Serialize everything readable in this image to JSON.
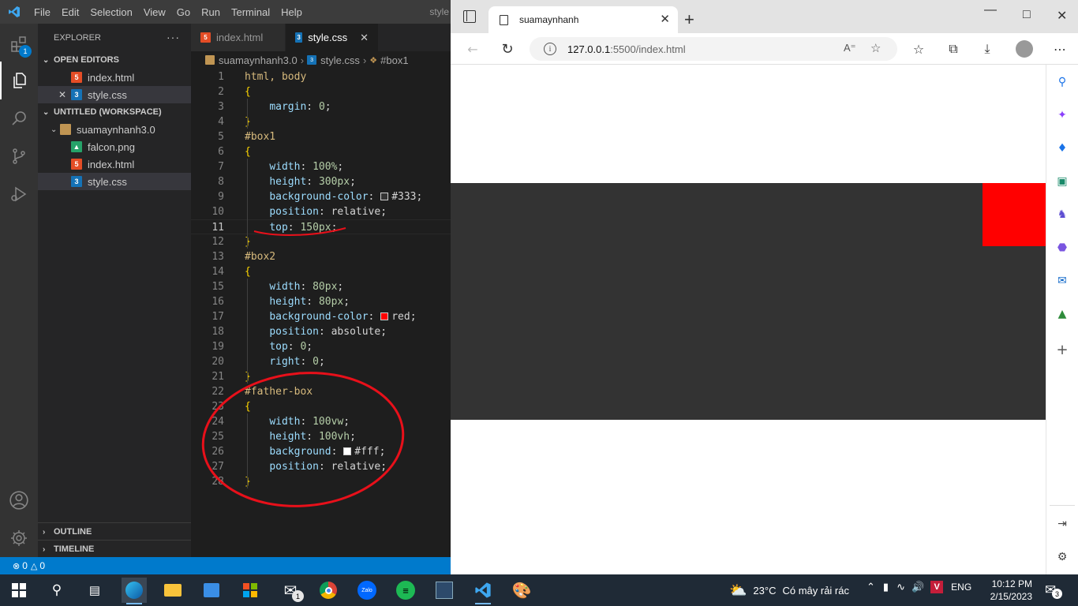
{
  "vscode": {
    "menu": [
      "File",
      "Edit",
      "Selection",
      "View",
      "Go",
      "Run",
      "Terminal",
      "Help"
    ],
    "window_title": "style",
    "explorer_title": "EXPLORER",
    "explorer_more": "···",
    "badge_count": "1",
    "open_editors_label": "OPEN EDITORS",
    "open_editors": [
      {
        "name": "index.html",
        "type": "html"
      },
      {
        "name": "style.css",
        "type": "css"
      }
    ],
    "workspace_label": "UNTITLED (WORKSPACE)",
    "folder": "suamaynhanh3.0",
    "files": [
      {
        "name": "falcon.png",
        "type": "png"
      },
      {
        "name": "index.html",
        "type": "html"
      },
      {
        "name": "style.css",
        "type": "css"
      }
    ],
    "outline_label": "OUTLINE",
    "timeline_label": "TIMELINE",
    "tabs": [
      {
        "label": "index.html",
        "type": "html"
      },
      {
        "label": "style.css",
        "type": "css"
      }
    ],
    "breadcrumb": [
      "suamaynhanh3.0",
      "style.css",
      "#box1"
    ],
    "status": {
      "errors": "0",
      "warnings": "0"
    },
    "current_line": 11,
    "code_lines": [
      "html, body",
      "{",
      "    margin: 0;",
      "}",
      "#box1",
      "{",
      "    width: 100%;",
      "    height: 300px;",
      "    background-color: #333;",
      "    position: relative;",
      "    top: 150px;",
      "}",
      "#box2",
      "{",
      "    width: 80px;",
      "    height: 80px;",
      "    background-color: red;",
      "    position: absolute;",
      "    top: 0;",
      "    right: 0;",
      "}",
      "#father-box",
      "{",
      "    width: 100vw;",
      "    height: 100vh;",
      "    background: #fff;",
      "    position: relative;",
      "}"
    ]
  },
  "browser": {
    "tab_title": "suamaynhanh",
    "url_host": "127.0.0.1",
    "url_path": ":5500/index.html",
    "colors": {
      "box1": "#333333",
      "box2": "#ff0000",
      "page": "#ffffff"
    }
  },
  "taskbar": {
    "temperature": "23°C",
    "weather": "Có mây rải rác",
    "language": "ENG",
    "time": "10:12 PM",
    "date": "2/15/2023",
    "notifications": "3",
    "mail_badge": "1"
  },
  "annotation_color": "#e8101a"
}
